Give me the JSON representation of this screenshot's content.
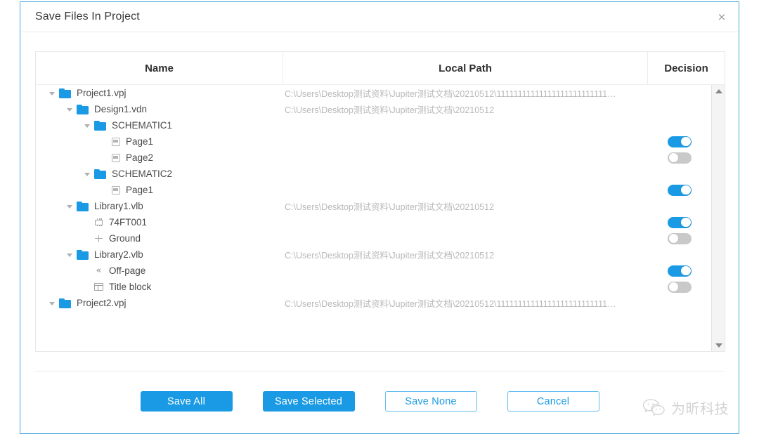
{
  "dialog": {
    "title": "Save Files In Project",
    "close_label": "×",
    "accent_color": "#1a9ae4",
    "border_color": "#4aa8db"
  },
  "table": {
    "columns": [
      "Name",
      "Local Path",
      "Decision"
    ],
    "rows": [
      {
        "name": "Project1.vpj",
        "depth": 0,
        "icon": "folder-icon",
        "caret": true,
        "path": "C:\\Users\\Desktop测试资料\\Jupiter测试文档\\20210512\\11111111111111111111111111…",
        "toggle": null
      },
      {
        "name": "Design1.vdn",
        "depth": 1,
        "icon": "folder-icon",
        "caret": true,
        "path": "C:\\Users\\Desktop测试资料\\Jupiter测试文档\\20210512",
        "toggle": null
      },
      {
        "name": "SCHEMATIC1",
        "depth": 2,
        "icon": "folder-icon",
        "caret": true,
        "path": "",
        "toggle": null
      },
      {
        "name": "Page1",
        "depth": 3,
        "icon": "page-icon",
        "caret": false,
        "path": "",
        "toggle": "on"
      },
      {
        "name": "Page2",
        "depth": 3,
        "icon": "page-icon",
        "caret": false,
        "path": "",
        "toggle": "off"
      },
      {
        "name": "SCHEMATIC2",
        "depth": 2,
        "icon": "folder-icon",
        "caret": true,
        "path": "",
        "toggle": null
      },
      {
        "name": "Page1",
        "depth": 3,
        "icon": "page-icon",
        "caret": false,
        "path": "",
        "toggle": "on"
      },
      {
        "name": "Library1.vlb",
        "depth": 1,
        "icon": "folder-icon",
        "caret": true,
        "path": "C:\\Users\\Desktop测试资料\\Jupiter测试文档\\20210512",
        "toggle": null
      },
      {
        "name": "74FT001",
        "depth": 2,
        "icon": "chip-icon",
        "caret": false,
        "path": "",
        "toggle": "on"
      },
      {
        "name": "Ground",
        "depth": 2,
        "icon": "ground-icon",
        "caret": false,
        "path": "",
        "toggle": "off"
      },
      {
        "name": "Library2.vlb",
        "depth": 1,
        "icon": "folder-icon",
        "caret": true,
        "path": "C:\\Users\\Desktop测试资料\\Jupiter测试文档\\20210512",
        "toggle": null
      },
      {
        "name": "Off-page",
        "depth": 2,
        "icon": "offpage-icon",
        "caret": false,
        "path": "",
        "toggle": "on"
      },
      {
        "name": "Title block",
        "depth": 2,
        "icon": "titleblock-icon",
        "caret": false,
        "path": "",
        "toggle": "off"
      },
      {
        "name": "Project2.vpj",
        "depth": 0,
        "icon": "folder-icon",
        "caret": true,
        "path": "C:\\Users\\Desktop测试资料\\Jupiter测试文档\\20210512\\11111111111111111111111111…",
        "toggle": null
      }
    ]
  },
  "footer": {
    "buttons": [
      {
        "label": "Save All",
        "style": "primary"
      },
      {
        "label": "Save Selected",
        "style": "primary"
      },
      {
        "label": "Save None",
        "style": "outline"
      },
      {
        "label": "Cancel",
        "style": "outline"
      }
    ]
  },
  "watermark": {
    "text": "为昕科技"
  }
}
